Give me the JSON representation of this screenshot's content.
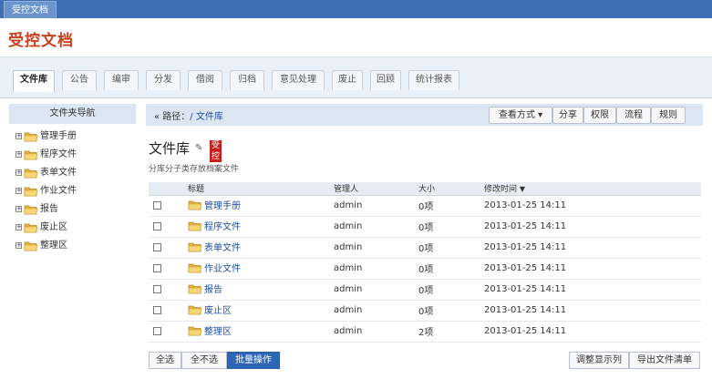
{
  "window": {
    "tab_label": "受控文档"
  },
  "header": {
    "title": "受控文档"
  },
  "tabs": [
    {
      "label": "文件库",
      "active": true
    },
    {
      "label": "公告"
    },
    {
      "label": "编审"
    },
    {
      "label": "分发"
    },
    {
      "label": "借阅"
    },
    {
      "label": "归档"
    },
    {
      "label": "意见处理"
    },
    {
      "label": "废止"
    },
    {
      "label": "回顾"
    },
    {
      "label": "统计报表"
    }
  ],
  "sidebar": {
    "title": "文件夹导航",
    "expand_symbol": "+",
    "items": [
      {
        "label": "管理手册"
      },
      {
        "label": "程序文件"
      },
      {
        "label": "表单文件"
      },
      {
        "label": "作业文件"
      },
      {
        "label": "报告"
      },
      {
        "label": "废止区"
      },
      {
        "label": "整理区"
      }
    ]
  },
  "breadcrumb": {
    "prefix": "« 路径：",
    "path": "/ 文件库"
  },
  "toolbar": {
    "view_mode": "查看方式 ▾",
    "share": "分享",
    "permissions": "权限",
    "workflow": "流程",
    "rules": "规则"
  },
  "page": {
    "title": "文件库",
    "edit_symbol": "✎",
    "badge": "受控",
    "description": "分库分子类存放档案文件"
  },
  "table": {
    "columns": {
      "title": "标题",
      "manager": "管理人",
      "size": "大小",
      "modified": "修改时间",
      "sort_caret": "▼"
    },
    "rows": [
      {
        "title": "管理手册",
        "manager": "admin",
        "size": "0项",
        "modified": "2013-01-25 14:11"
      },
      {
        "title": "程序文件",
        "manager": "admin",
        "size": "0项",
        "modified": "2013-01-25 14:11"
      },
      {
        "title": "表单文件",
        "manager": "admin",
        "size": "0项",
        "modified": "2013-01-25 14:11"
      },
      {
        "title": "作业文件",
        "manager": "admin",
        "size": "0项",
        "modified": "2013-01-25 14:11"
      },
      {
        "title": "报告",
        "manager": "admin",
        "size": "0项",
        "modified": "2013-01-25 14:11"
      },
      {
        "title": "废止区",
        "manager": "admin",
        "size": "0项",
        "modified": "2013-01-25 14:11"
      },
      {
        "title": "整理区",
        "manager": "admin",
        "size": "2项",
        "modified": "2013-01-25 14:11"
      }
    ]
  },
  "footer": {
    "select_all": "全选",
    "select_none": "全不选",
    "batch": "批量操作",
    "adjust_columns": "调整显示列",
    "export": "导出文件清单"
  },
  "colors": {
    "brand_title": "#c8411d",
    "topbar": "#3e6fb4",
    "link": "#1f4fa6",
    "badge": "#c6201e",
    "primary_button": "#2d66b5"
  }
}
